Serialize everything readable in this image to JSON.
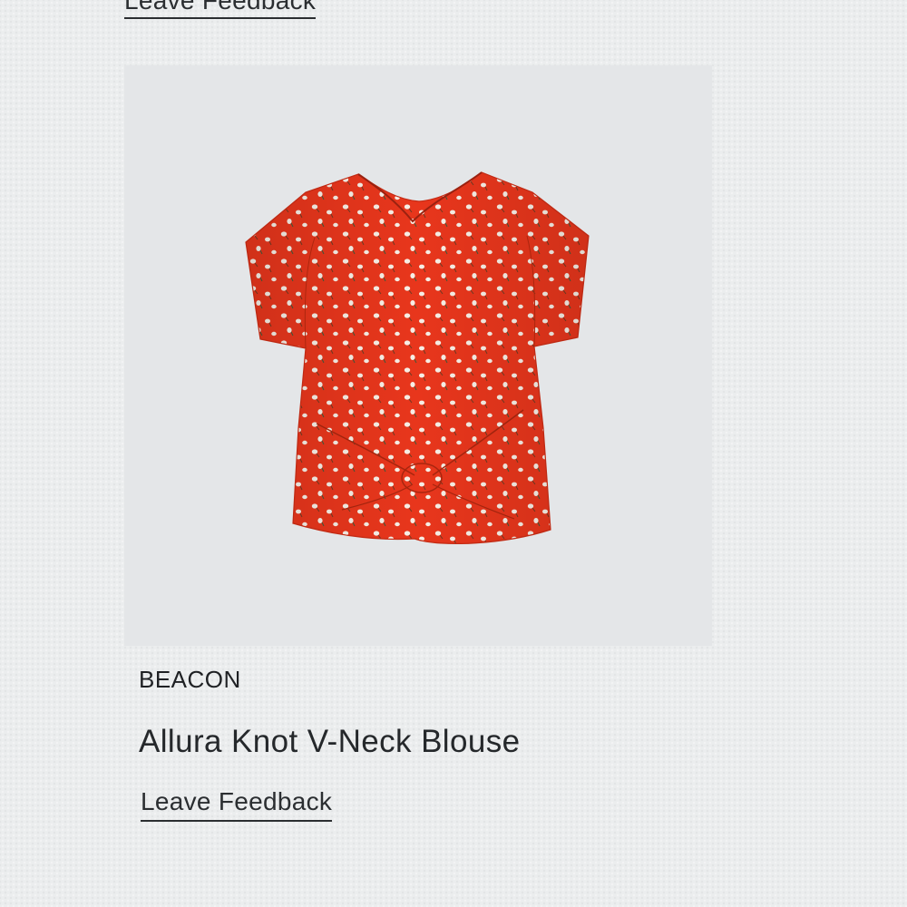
{
  "previous_item": {
    "feedback_link_label": "Leave Feedback"
  },
  "product": {
    "image_icon": "blouse-image",
    "image_colors": {
      "fabric": "#e8361c",
      "print": "#f7efe6",
      "background": "#e4e6e8"
    },
    "brand": "BEACON",
    "name": "Allura Knot V-Neck Blouse",
    "feedback_link_label": "Leave Feedback"
  }
}
